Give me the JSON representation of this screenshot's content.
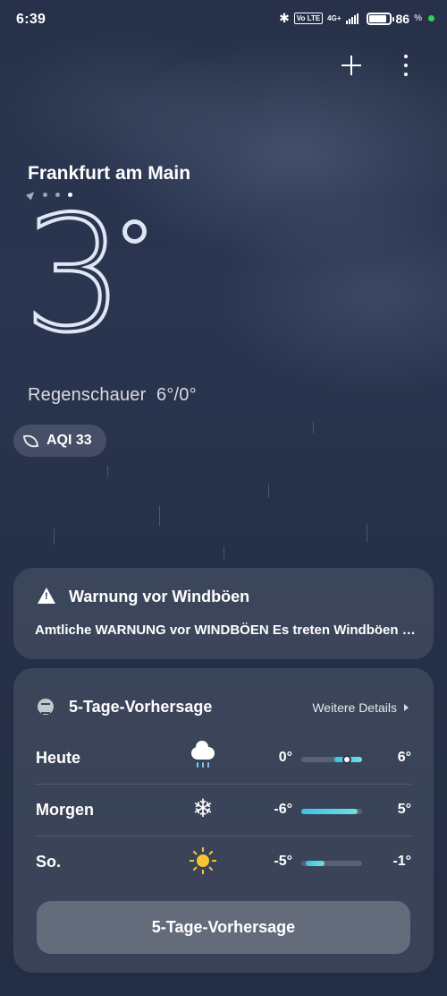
{
  "status_bar": {
    "time": "6:39",
    "network": "4G+",
    "volte": "Vo LTE",
    "battery_percent": "86",
    "battery_unit": "%",
    "battery_level": 0.86,
    "bluetooth_icon": "bluetooth-icon"
  },
  "toolbar": {
    "add_icon": "plus-icon",
    "menu_icon": "more-vertical-icon"
  },
  "location": {
    "city": "Frankfurt am Main",
    "page_count": 4,
    "active_page": 4
  },
  "current": {
    "temperature": "3",
    "condition": "Regenschauer",
    "range": "6°/0°",
    "aqi_label": "AQI 33",
    "aqi_icon": "leaf-icon"
  },
  "warning": {
    "icon": "warning-icon",
    "title": "Warnung vor Windböen",
    "text": "Amtliche WARNUNG vor WINDBÖEN Es treten Windböen auf"
  },
  "forecast": {
    "title": "5-Tage-Vorhersage",
    "more_label": "Weitere Details",
    "days": [
      {
        "day": "Heute",
        "icon": "rain-cloud-icon",
        "low": "0°",
        "high": "6°",
        "bar_start": 0.55,
        "bar_end": 1.0,
        "current": 0.75
      },
      {
        "day": "Morgen",
        "icon": "snowflake-icon",
        "low": "-6°",
        "high": "5°",
        "bar_start": 0.0,
        "bar_end": 0.92,
        "current": null
      },
      {
        "day": "So.",
        "icon": "sun-icon",
        "low": "-5°",
        "high": "-1°",
        "bar_start": 0.08,
        "bar_end": 0.38,
        "current": null
      }
    ],
    "cta_label": "5-Tage-Vorhersage"
  }
}
